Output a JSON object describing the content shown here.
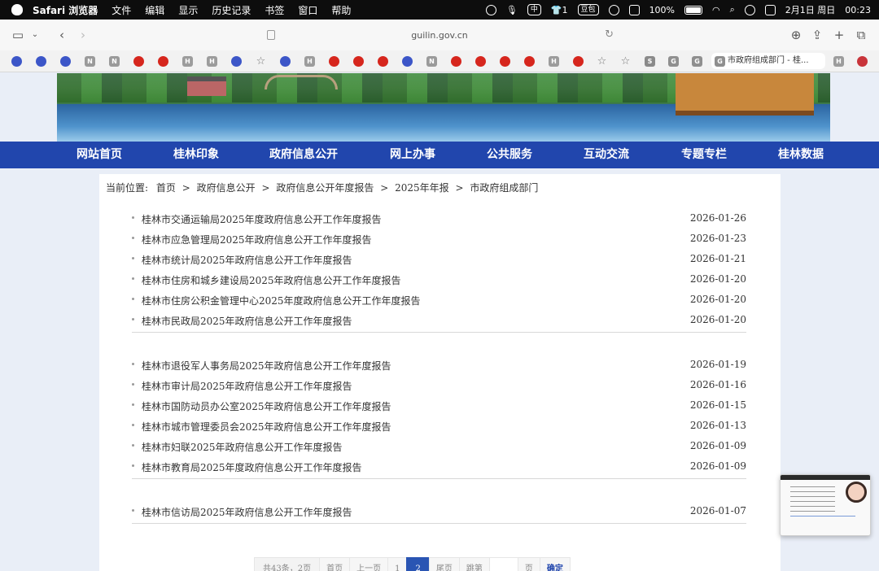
{
  "menubar": {
    "app": "Safari 浏览器",
    "items": [
      "文件",
      "编辑",
      "显示",
      "历史记录",
      "书签",
      "窗口",
      "帮助"
    ],
    "status": {
      "badge_1": "1",
      "pill": "豆包",
      "battery": "100%",
      "battery_level": 1.0,
      "date": "2月1日 周日",
      "time": "00:23"
    }
  },
  "browser": {
    "url": "guilin.gov.cn",
    "bookmarks": [
      "",
      "",
      "",
      "N",
      "N",
      "",
      "",
      "H",
      "H",
      "",
      "",
      "",
      "H",
      "",
      "",
      "",
      "N",
      "",
      "",
      "",
      "",
      "H",
      "",
      "",
      "",
      "S",
      "G",
      "G"
    ],
    "active_tab_icon": "G",
    "active_tab": "市政府组成部门 - 桂..."
  },
  "site": {
    "nav": [
      "网站首页",
      "桂林印象",
      "政府信息公开",
      "网上办事",
      "公共服务",
      "互动交流",
      "专题专栏",
      "桂林数据"
    ],
    "breadcrumb": {
      "label": "当前位置:",
      "parts": [
        "首页",
        "政府信息公开",
        "政府信息公开年度报告",
        "2025年年报",
        "市政府组成部门"
      ],
      "sep": ">"
    },
    "groups": [
      [
        {
          "title": "桂林市交通运输局2025年度政府信息公开工作年度报告",
          "date": "2026-01-26"
        },
        {
          "title": "桂林市应急管理局2025年政府信息公开工作年度报告",
          "date": "2026-01-23"
        },
        {
          "title": "桂林市统计局2025年政府信息公开工作年度报告",
          "date": "2026-01-21"
        },
        {
          "title": "桂林市住房和城乡建设局2025年政府信息公开工作年度报告",
          "date": "2026-01-20"
        },
        {
          "title": "桂林市住房公积金管理中心2025年度政府信息公开工作年度报告",
          "date": "2026-01-20"
        },
        {
          "title": "桂林市民政局2025年政府信息公开工作年度报告",
          "date": "2026-01-20"
        }
      ],
      [
        {
          "title": "桂林市退役军人事务局2025年政府信息公开工作年度报告",
          "date": "2026-01-19"
        },
        {
          "title": "桂林市审计局2025年政府信息公开工作年度报告",
          "date": "2026-01-16"
        },
        {
          "title": "桂林市国防动员办公室2025年政府信息公开工作年度报告",
          "date": "2026-01-15"
        },
        {
          "title": "桂林市城市管理委员会2025年政府信息公开工作年度报告",
          "date": "2026-01-13"
        },
        {
          "title": "桂林市妇联2025年政府信息公开工作年度报告",
          "date": "2026-01-09"
        },
        {
          "title": "桂林市教育局2025年度政府信息公开工作年度报告",
          "date": "2026-01-09"
        }
      ],
      [
        {
          "title": "桂林市信访局2025年政府信息公开工作年度报告",
          "date": "2026-01-07"
        }
      ]
    ],
    "pager": {
      "info": "共43条，2页",
      "first": "首页",
      "prev": "上一页",
      "pages": [
        "1",
        "2"
      ],
      "current": "2",
      "last": "尾页",
      "jump_label": "跳第",
      "jump_value": "",
      "page_suffix": "页",
      "go": "确定"
    }
  }
}
